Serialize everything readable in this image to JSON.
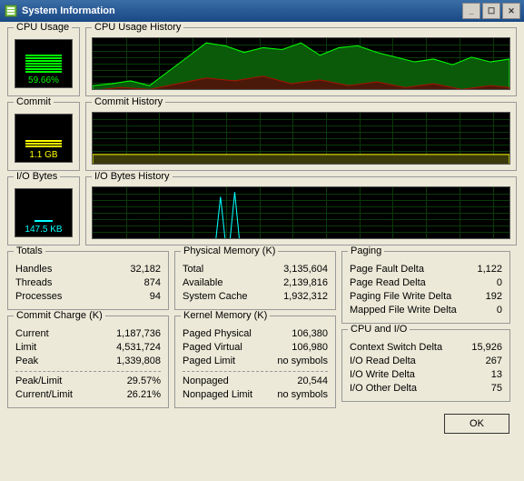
{
  "window": {
    "title": "System Information"
  },
  "meters": {
    "cpu": {
      "label": "CPU Usage",
      "value": "59.66%",
      "historyLabel": "CPU Usage History"
    },
    "commit": {
      "label": "Commit",
      "value": "1.1 GB",
      "historyLabel": "Commit History"
    },
    "io": {
      "label": "I/O Bytes",
      "value": "147.5 KB",
      "historyLabel": "I/O Bytes History"
    }
  },
  "totals": {
    "title": "Totals",
    "handles": {
      "label": "Handles",
      "value": "32,182"
    },
    "threads": {
      "label": "Threads",
      "value": "874"
    },
    "processes": {
      "label": "Processes",
      "value": "94"
    }
  },
  "commitCharge": {
    "title": "Commit Charge (K)",
    "current": {
      "label": "Current",
      "value": "1,187,736"
    },
    "limit": {
      "label": "Limit",
      "value": "4,531,724"
    },
    "peak": {
      "label": "Peak",
      "value": "1,339,808"
    },
    "peakLimit": {
      "label": "Peak/Limit",
      "value": "29.57%"
    },
    "currentLimit": {
      "label": "Current/Limit",
      "value": "26.21%"
    }
  },
  "physicalMemory": {
    "title": "Physical Memory (K)",
    "total": {
      "label": "Total",
      "value": "3,135,604"
    },
    "available": {
      "label": "Available",
      "value": "2,139,816"
    },
    "systemCache": {
      "label": "System Cache",
      "value": "1,932,312"
    }
  },
  "kernelMemory": {
    "title": "Kernel Memory (K)",
    "pagedPhysical": {
      "label": "Paged Physical",
      "value": "106,380"
    },
    "pagedVirtual": {
      "label": "Paged Virtual",
      "value": "106,980"
    },
    "pagedLimit": {
      "label": "Paged Limit",
      "value": "no symbols"
    },
    "nonpaged": {
      "label": "Nonpaged",
      "value": "20,544"
    },
    "nonpagedLimit": {
      "label": "Nonpaged Limit",
      "value": "no symbols"
    }
  },
  "paging": {
    "title": "Paging",
    "pageFaultDelta": {
      "label": "Page Fault Delta",
      "value": "1,122"
    },
    "pageReadDelta": {
      "label": "Page Read Delta",
      "value": "0"
    },
    "pagingFileWriteDelta": {
      "label": "Paging File Write Delta",
      "value": "192"
    },
    "mappedFileWriteDelta": {
      "label": "Mapped File Write Delta",
      "value": "0"
    }
  },
  "cpuIo": {
    "title": "CPU and I/O",
    "contextSwitchDelta": {
      "label": "Context Switch Delta",
      "value": "15,926"
    },
    "ioReadDelta": {
      "label": "I/O Read Delta",
      "value": "267"
    },
    "ioWriteDelta": {
      "label": "I/O Write Delta",
      "value": "13"
    },
    "ioOtherDelta": {
      "label": "I/O Other Delta",
      "value": "75"
    }
  },
  "buttons": {
    "ok": "OK"
  }
}
